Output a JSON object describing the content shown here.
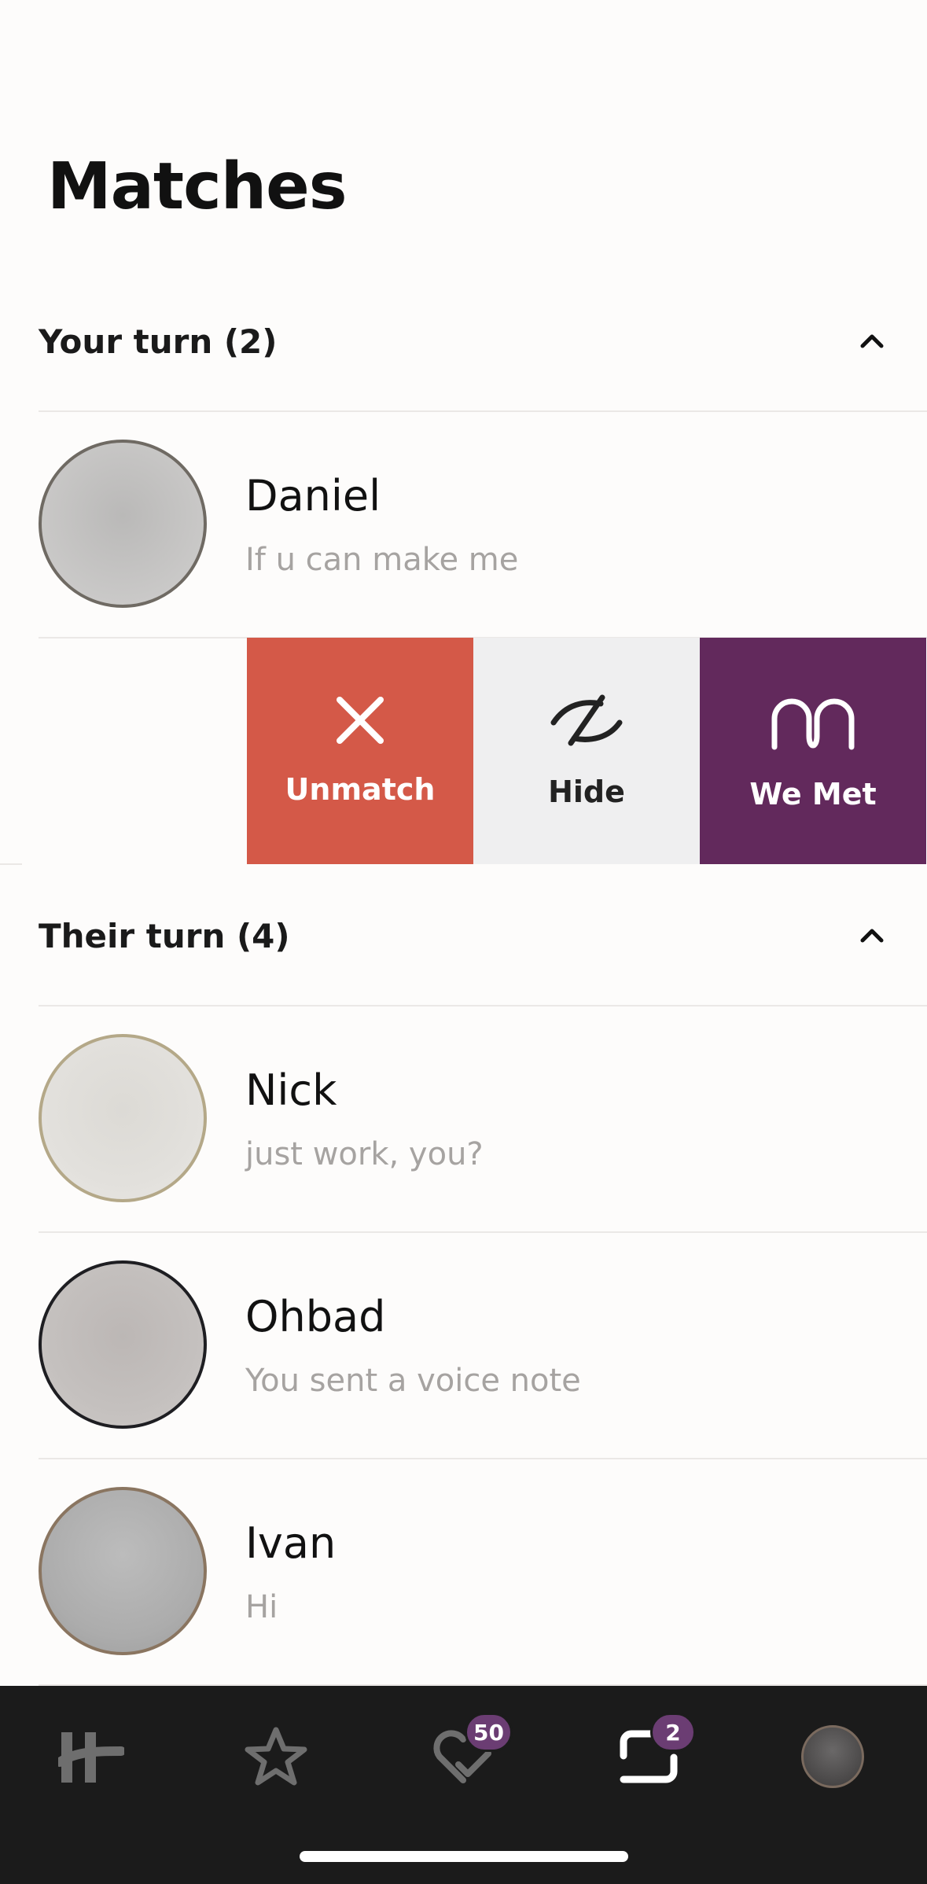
{
  "page": {
    "title": "Matches"
  },
  "sections": {
    "your_turn": {
      "label": "Your turn (2)"
    },
    "their_turn": {
      "label": "Their turn (4)"
    }
  },
  "your_turn_rows": [
    {
      "name": "Daniel",
      "message": "If u can make me"
    }
  ],
  "swipe_actions": {
    "unmatch": "Unmatch",
    "hide": "Hide",
    "we_met": "We Met"
  },
  "their_turn_rows": [
    {
      "name": "Nick",
      "message": "just work, you?"
    },
    {
      "name": "Ohbad",
      "message": "You sent a voice note"
    },
    {
      "name": "Ivan",
      "message": "Hi"
    }
  ],
  "tabbar": {
    "tabs": [
      {
        "name": "discover",
        "icon": "hinge-logo-icon"
      },
      {
        "name": "standouts",
        "icon": "star-icon"
      },
      {
        "name": "likes",
        "icon": "heart-check-icon",
        "badge": "50"
      },
      {
        "name": "matches",
        "icon": "chat-bubbles-icon",
        "badge": "2"
      },
      {
        "name": "profile",
        "icon": "avatar"
      }
    ]
  },
  "colors": {
    "accent": "#62295c",
    "unmatch": "#d45948",
    "hide": "#efeff0",
    "tabbar_bg": "#1b1b1b",
    "badge": "#6b3d73"
  }
}
